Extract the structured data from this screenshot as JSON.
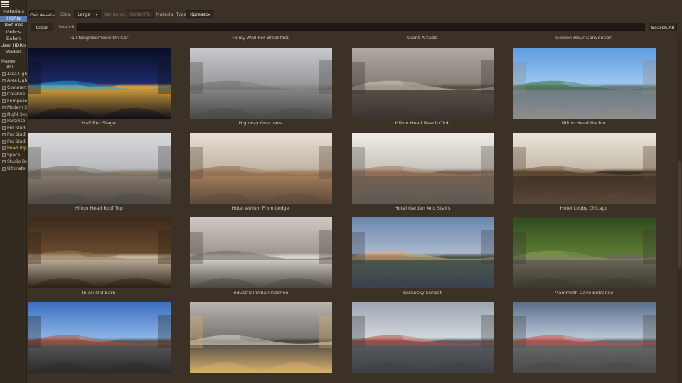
{
  "sidebar": {
    "menu_icon": "hamburger-menu-icon",
    "tabs": [
      {
        "label": "Materials",
        "active": false
      },
      {
        "label": "HDRIs",
        "active": true
      },
      {
        "label": "Textures",
        "active": false
      },
      {
        "label": "Gobos",
        "active": false
      },
      {
        "label": "Bokeh",
        "active": false
      },
      {
        "label": "User HDRIs",
        "active": false
      },
      {
        "label": "Models",
        "active": false
      }
    ],
    "filter_label": "Name:",
    "filters": [
      {
        "label": "ALL",
        "all": true
      },
      {
        "label": "Area Ligh"
      },
      {
        "label": "Area Ligh"
      },
      {
        "label": "Commerc"
      },
      {
        "label": "Creative"
      },
      {
        "label": "European"
      },
      {
        "label": "Modern S"
      },
      {
        "label": "Night Sky"
      },
      {
        "label": "Paradise"
      },
      {
        "label": "Pro Studi"
      },
      {
        "label": "Pro Studi"
      },
      {
        "label": "Pro Studi"
      },
      {
        "label": "Road Trip",
        "highlight": true
      },
      {
        "label": "Space"
      },
      {
        "label": "Studio Bo"
      },
      {
        "label": "Ultimate"
      }
    ]
  },
  "toolbar": {
    "get_assets": "Get Assets",
    "size_label": "Size:",
    "size_value": "Large",
    "renderer_label": "Renderer:",
    "renderer_value": "Redshift",
    "material_type_label": "Material Type:",
    "material_type_value": "Xpresso",
    "clear": "Clear",
    "search_label": "Search:",
    "search_value": "",
    "search_all": "Search All"
  },
  "grid": {
    "top_captions": [
      "Fall Neighborhood On Car",
      "Fancy Wall For Breakfast",
      "Giant Arcade",
      "Golden Hour Convention"
    ],
    "rows": [
      [
        "Half Rez Stage",
        "Highway Overpass",
        "Hilton Head Beach Club",
        "Hilton Head Harbor"
      ],
      [
        "Hilton Head Roof Top",
        "Hotel Atrium From Ledge",
        "Hotel Garden And Stairs",
        "Hotel Lobby Chicago"
      ],
      [
        "In An Old Barn",
        "Industrial Urban Kitchen",
        "Kentucky Sunset",
        "Mammoth Cave Entrance"
      ],
      [
        "",
        "",
        "",
        ""
      ]
    ]
  },
  "colors": {
    "background": "#3b3126",
    "active_tab": "#5b7aa8",
    "highlight": "#f2c94c"
  }
}
